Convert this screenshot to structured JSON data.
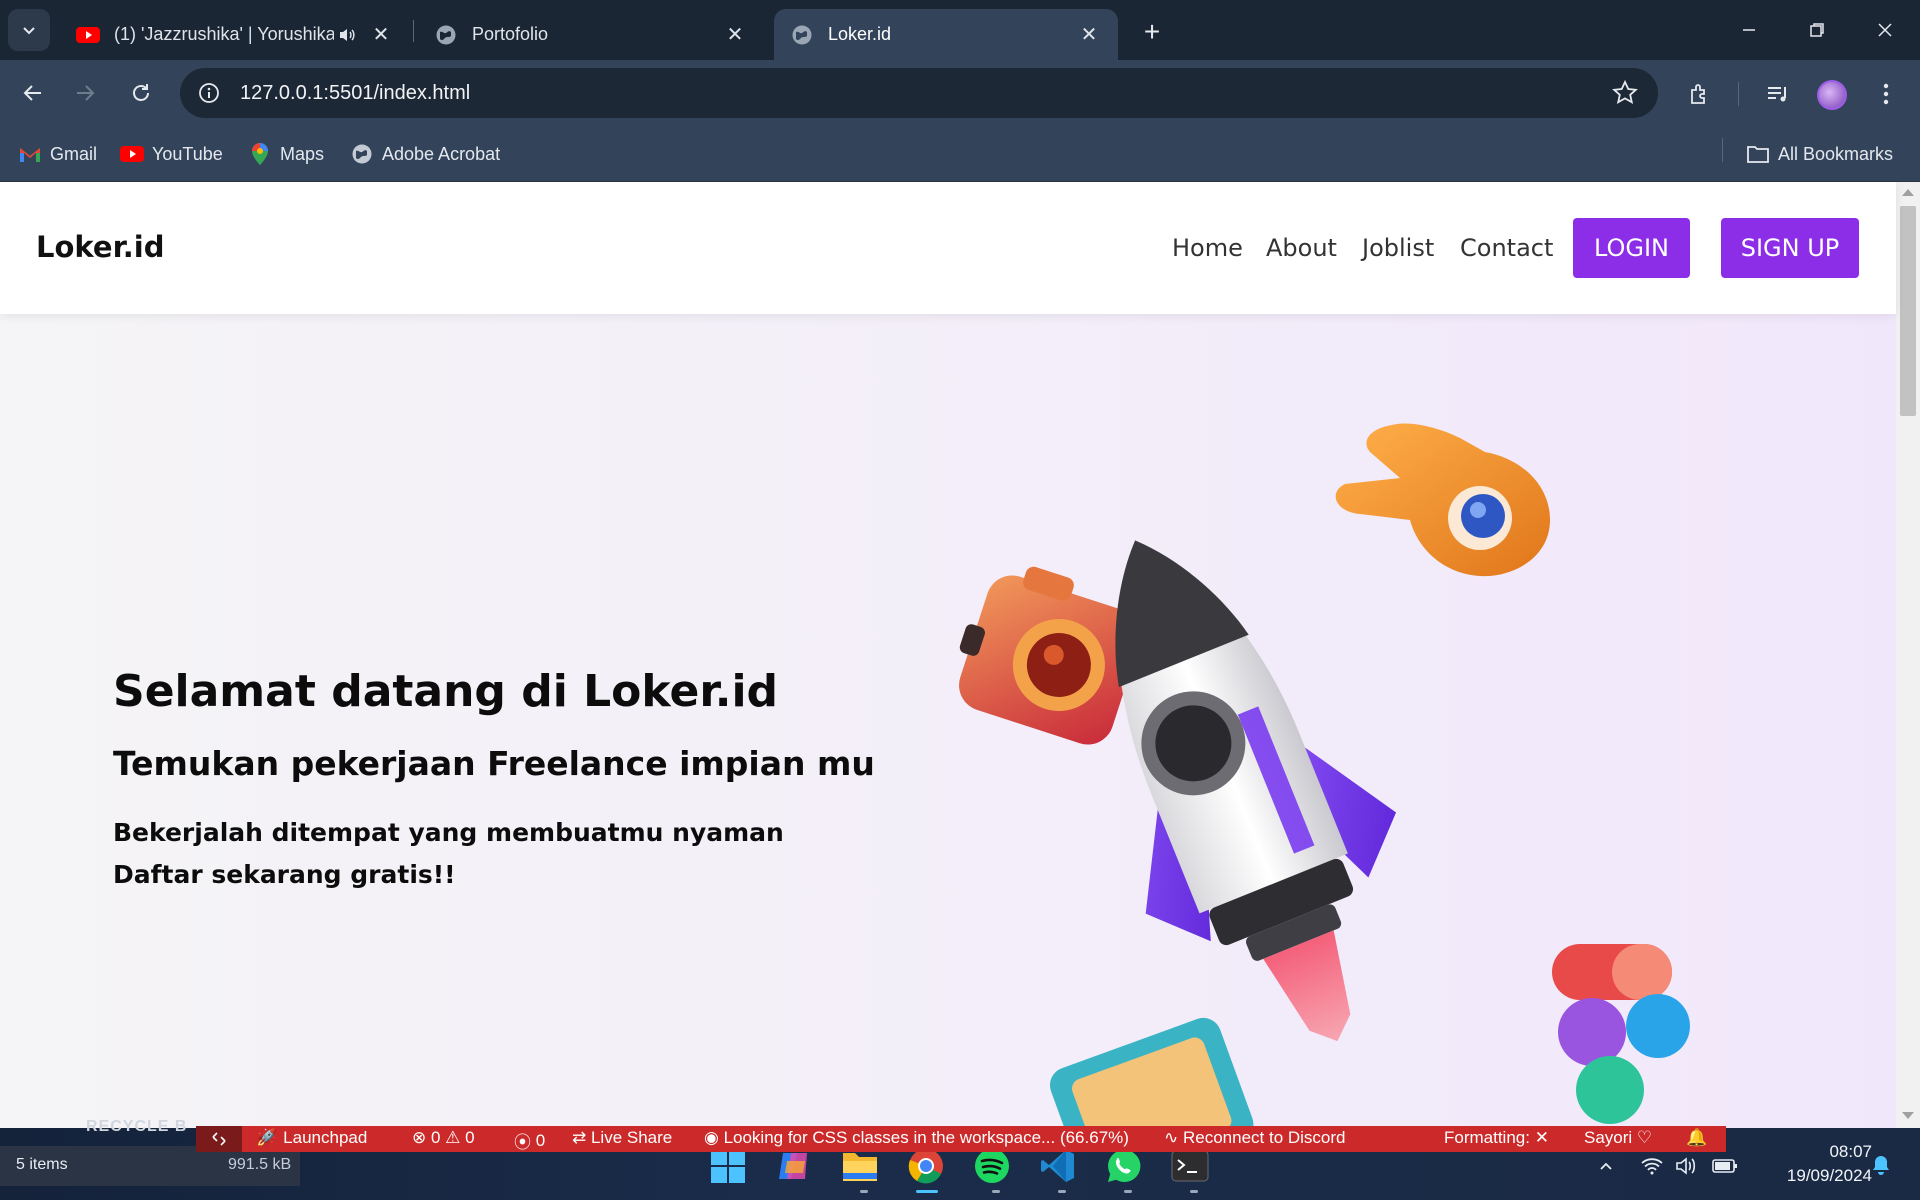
{
  "browser": {
    "tabs": [
      {
        "title": "(1) 'Jazzrushika' | Yorushika",
        "favicon": "youtube-icon",
        "audio": true
      },
      {
        "title": "Portofolio",
        "favicon": "globe-icon"
      },
      {
        "title": "Loker.id",
        "favicon": "globe-icon",
        "active": true
      }
    ],
    "url": "127.0.0.1:5501/index.html",
    "bookmarks": [
      {
        "label": "Gmail",
        "icon": "gmail-icon"
      },
      {
        "label": "YouTube",
        "icon": "youtube-icon"
      },
      {
        "label": "Maps",
        "icon": "maps-icon"
      },
      {
        "label": "Adobe Acrobat",
        "icon": "globe-icon"
      }
    ],
    "all_bookmarks": "All Bookmarks"
  },
  "site": {
    "brand": "Loker.id",
    "nav": [
      "Home",
      "About",
      "Joblist",
      "Contact"
    ],
    "login": "LOGIN",
    "signup": "SIGN UP",
    "accent": "#8c2ee8"
  },
  "hero": {
    "title": "Selamat datang di Loker.id",
    "subtitle": "Temukan pekerjaan Freelance impian mu",
    "line1": "Bekerjalah ditempat yang membuatmu nyaman",
    "line2": "Daftar sekarang gratis!!"
  },
  "vscode_status": {
    "launchpad": "Launchpad",
    "errors": "0",
    "warnings": "0",
    "ports": "0",
    "live_share": "Live Share",
    "message": "Looking for CSS classes in the workspace... (66.67%)",
    "discord": "Reconnect to Discord",
    "formatting": "Formatting:",
    "sayori": "Sayori",
    "color": "#cc2a2a"
  },
  "explorer": {
    "recycle": "RECYCLE B",
    "items": "5 items",
    "size": "991.5 kB"
  },
  "taskbar": {
    "time": "08:07",
    "date": "19/09/2024",
    "apps": [
      "windows-start-icon",
      "copilot-icon",
      "file-explorer-icon",
      "chrome-icon",
      "spotify-icon",
      "vscode-icon",
      "whatsapp-icon",
      "terminal-icon"
    ]
  }
}
